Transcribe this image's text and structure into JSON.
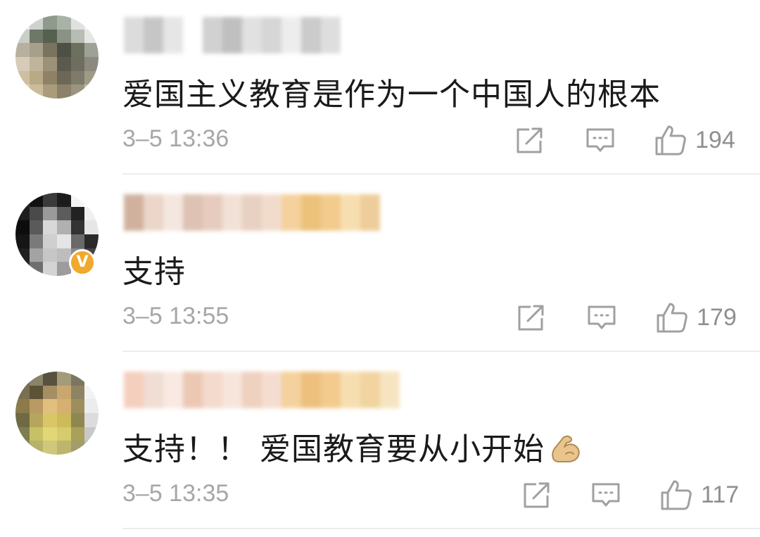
{
  "comments": [
    {
      "text": "爱国主义教育是作为一个中国人的根本",
      "timestamp": "3–5 13:36",
      "likes": "194",
      "verified": false,
      "avatar_colors": [
        "#e9ecea",
        "#cfd3cf",
        "#8f9a8c",
        "#a9b2a6",
        "#dfe3df",
        "#f2f4f2",
        "#c9cfc7",
        "#6d7866",
        "#55604f",
        "#8a9285",
        "#b7bdb4",
        "#e4e7e3",
        "#b8b09e",
        "#a89f8b",
        "#7a7360",
        "#4e4f45",
        "#6c705f",
        "#9ea296",
        "#d6ccb8",
        "#bfb49c",
        "#9d9179",
        "#5b5a4e",
        "#6e6d60",
        "#8c8a7c",
        "#cdbf9f",
        "#b9aa86",
        "#8e8166",
        "#6d6756",
        "#7f7b6a",
        "#a09b87",
        "#ddd0b2",
        "#cbbd9b",
        "#a99b7c",
        "#8b8269",
        "#9b957f",
        "#c4bea8"
      ],
      "username_colors": [
        "#d6d6d6",
        "#bdbdbd",
        "#e2e2e2",
        "#ffffff",
        "#c9c9c9",
        "#b5b5b5",
        "#dcdcdc",
        "#cfcfcf",
        "#ebebeb",
        "#c2c2c2",
        "#d9d9d9"
      ]
    },
    {
      "text": "支持",
      "timestamp": "3–5 13:55",
      "likes": "179",
      "verified": true,
      "verified_badge": "V",
      "avatar_colors": [
        "#2b2b2b",
        "#111111",
        "#3a3a3a",
        "#1c1c1c",
        "#f5f5f5",
        "#ffffff",
        "#1e1e1e",
        "#4a4a4a",
        "#9a9a9a",
        "#5c5c5c",
        "#222222",
        "#f0f0f0",
        "#0d0d0d",
        "#5a5a5a",
        "#d8d8d8",
        "#b0b0b0",
        "#333333",
        "#e6e6e6",
        "#151515",
        "#7a7a7a",
        "#cfcfcf",
        "#e5e5e5",
        "#6a6a6a",
        "#2a2a2a",
        "#202020",
        "#a3a3a3",
        "#c6c6c6",
        "#bdbdbd",
        "#8c8c8c",
        "#444444",
        "#2e2e2e",
        "#6f6f6f",
        "#d4d4d4",
        "#9c9c9c",
        "#ffffff",
        "#ffffff"
      ],
      "username_colors": [
        "#c9a48e",
        "#e8cfc0",
        "#f2e3da",
        "#d9b8a6",
        "#e2c3b3",
        "#f0dcd0",
        "#e5c9b8",
        "#efd7c4",
        "#f3c98c",
        "#e9b865",
        "#f0c27a",
        "#f6d9a4",
        "#ecc589"
      ]
    },
    {
      "text": "支持！！ 爱国教育要从小开始",
      "timestamp": "3–5 13:35",
      "likes": "117",
      "verified": false,
      "emoji": "flexed-biceps",
      "avatar_colors": [
        "#6e6a56",
        "#8a8468",
        "#57523f",
        "#a39b7a",
        "#7c7660",
        "#ffffff",
        "#7a6f4e",
        "#5c5236",
        "#a58e62",
        "#c9a76f",
        "#8e8462",
        "#f2f2f2",
        "#8c7a4c",
        "#b89a62",
        "#e0bf7f",
        "#d6b071",
        "#9e8d5e",
        "#ececec",
        "#6f6a44",
        "#b6a55c",
        "#d9c667",
        "#cdbb5a",
        "#8f8750",
        "#dcdcdc",
        "#7f7d4f",
        "#c7c064",
        "#e1d777",
        "#d5cc6d",
        "#a8a05b",
        "#c8c8c8",
        "#8d8a5f",
        "#b8b16b",
        "#cfc77a",
        "#bdb56f",
        "#a39c6b",
        "#bdbdbd"
      ],
      "username_colors": [
        "#f4c7b3",
        "#eed8cc",
        "#f7e6dd",
        "#e9bfa8",
        "#f2d4c4",
        "#f6e1d6",
        "#ecc9b5",
        "#f3d8c8",
        "#f3c98c",
        "#eab668",
        "#f0c27a",
        "#f6d9a4",
        "#efcd8f",
        "#f5e0b6"
      ]
    }
  ],
  "icons": {
    "share": "share-icon",
    "reply": "comment-icon",
    "like": "thumbs-up-icon"
  },
  "colors": {
    "text": "#1a1a1a",
    "meta": "#a7a7a7",
    "icon": "#a0a0a0",
    "verified": "#f0a92e",
    "divider": "#ececec"
  }
}
